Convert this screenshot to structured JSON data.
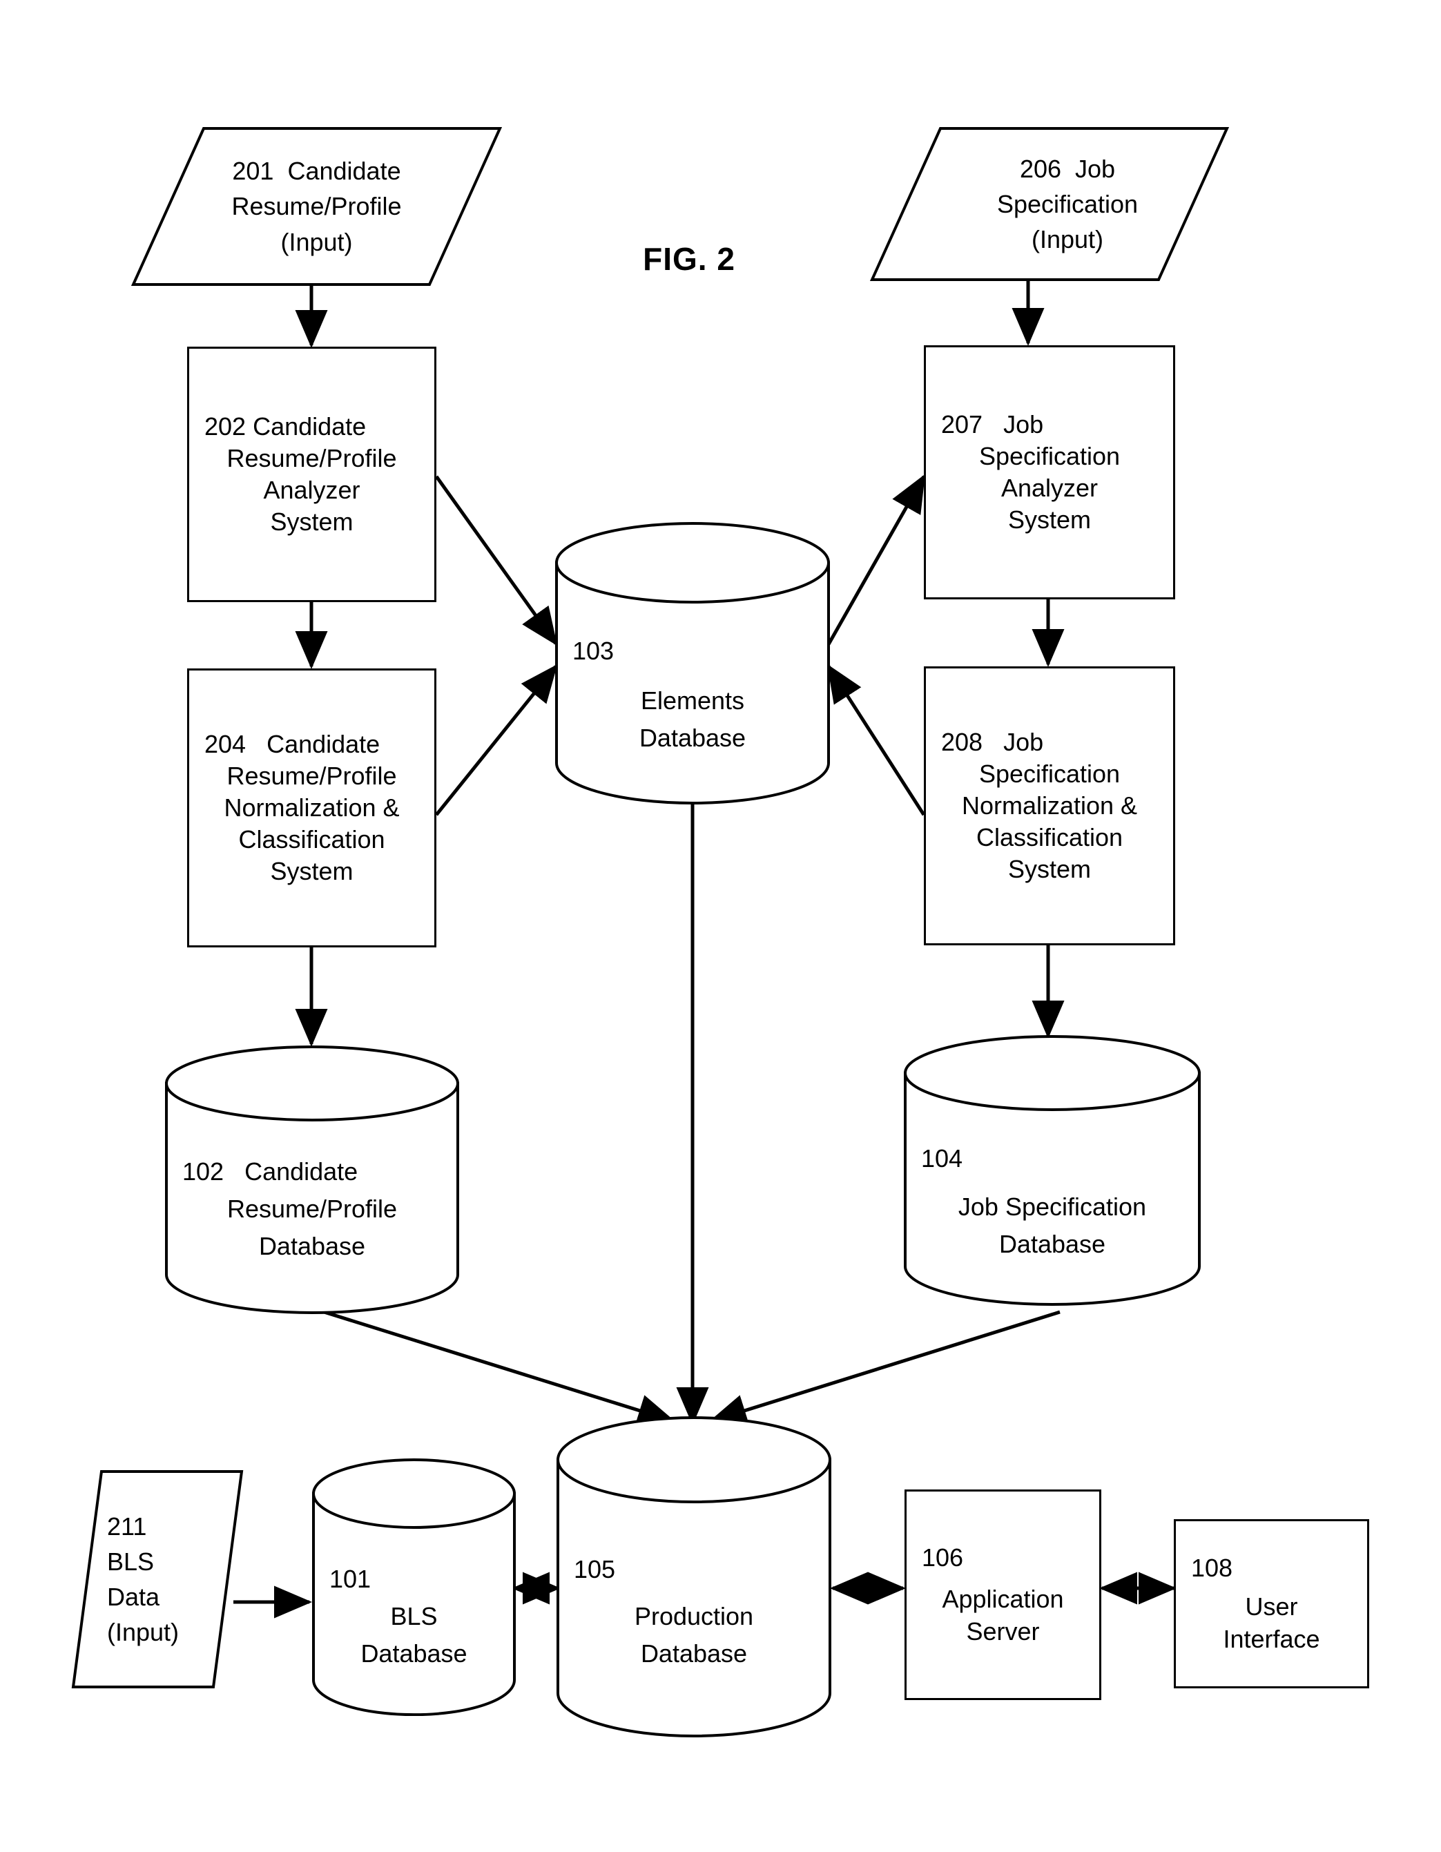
{
  "figure": {
    "title": "FIG. 2",
    "background_color": "#ffffff",
    "line_color": "#000000"
  },
  "nodes": {
    "n201": {
      "shape": "parallelogram",
      "id": "201",
      "lines": [
        "201  Candidate",
        "Resume/Profile",
        "(Input)"
      ]
    },
    "n202": {
      "shape": "rectangle",
      "id": "202",
      "lines": [
        "202 Candidate",
        "Resume/Profile",
        "Analyzer",
        "System"
      ]
    },
    "n204": {
      "shape": "rectangle",
      "id": "204",
      "lines": [
        "204   Candidate",
        "Resume/Profile",
        "Normalization &",
        "Classification",
        "System"
      ]
    },
    "n206": {
      "shape": "parallelogram",
      "id": "206",
      "lines": [
        "206  Job",
        "Specification",
        "(Input)"
      ]
    },
    "n207": {
      "shape": "rectangle",
      "id": "207",
      "lines": [
        "207   Job",
        "Specification",
        "Analyzer",
        "System"
      ]
    },
    "n208": {
      "shape": "rectangle",
      "id": "208",
      "lines": [
        "208   Job",
        "Specification",
        "Normalization &",
        "Classification",
        "System"
      ]
    },
    "n103": {
      "shape": "cylinder",
      "id": "103",
      "lines": [
        "103",
        "Elements",
        "Database"
      ]
    },
    "n102": {
      "shape": "cylinder",
      "id": "102",
      "lines": [
        "102   Candidate",
        "Resume/Profile",
        "Database"
      ]
    },
    "n104": {
      "shape": "cylinder",
      "id": "104",
      "lines": [
        "104",
        "Job Specification",
        "Database"
      ]
    },
    "n211": {
      "shape": "parallelogram",
      "id": "211",
      "lines": [
        "211",
        "BLS",
        "Data",
        "(Input)"
      ]
    },
    "n101": {
      "shape": "cylinder",
      "id": "101",
      "lines": [
        "101",
        "BLS",
        "Database"
      ]
    },
    "n105": {
      "shape": "cylinder",
      "id": "105",
      "lines": [
        "105",
        "Production",
        "Database"
      ]
    },
    "n106": {
      "shape": "rectangle",
      "id": "106",
      "lines": [
        "106",
        "Application",
        "Server"
      ]
    },
    "n108": {
      "shape": "rectangle",
      "id": "108",
      "lines": [
        "108",
        "User",
        "Interface"
      ]
    }
  },
  "edges": [
    {
      "from": "201",
      "to": "202",
      "style": "single-arrow"
    },
    {
      "from": "202",
      "to": "204",
      "style": "single-arrow"
    },
    {
      "from": "202",
      "to": "103",
      "style": "single-arrow"
    },
    {
      "from": "204",
      "to": "103",
      "style": "single-arrow"
    },
    {
      "from": "204",
      "to": "102",
      "style": "single-arrow"
    },
    {
      "from": "206",
      "to": "207",
      "style": "single-arrow"
    },
    {
      "from": "207",
      "to": "208",
      "style": "single-arrow"
    },
    {
      "from": "103",
      "to": "207",
      "style": "single-arrow"
    },
    {
      "from": "208",
      "to": "103",
      "style": "single-arrow"
    },
    {
      "from": "208",
      "to": "104",
      "style": "single-arrow"
    },
    {
      "from": "102",
      "to": "105",
      "style": "single-arrow"
    },
    {
      "from": "103",
      "to": "105",
      "style": "single-arrow"
    },
    {
      "from": "104",
      "to": "105",
      "style": "single-arrow"
    },
    {
      "from": "211",
      "to": "101",
      "style": "single-arrow"
    },
    {
      "from": "101",
      "to": "105",
      "style": "double-arrow"
    },
    {
      "from": "105",
      "to": "106",
      "style": "double-arrow"
    },
    {
      "from": "106",
      "to": "108",
      "style": "double-arrow"
    }
  ]
}
